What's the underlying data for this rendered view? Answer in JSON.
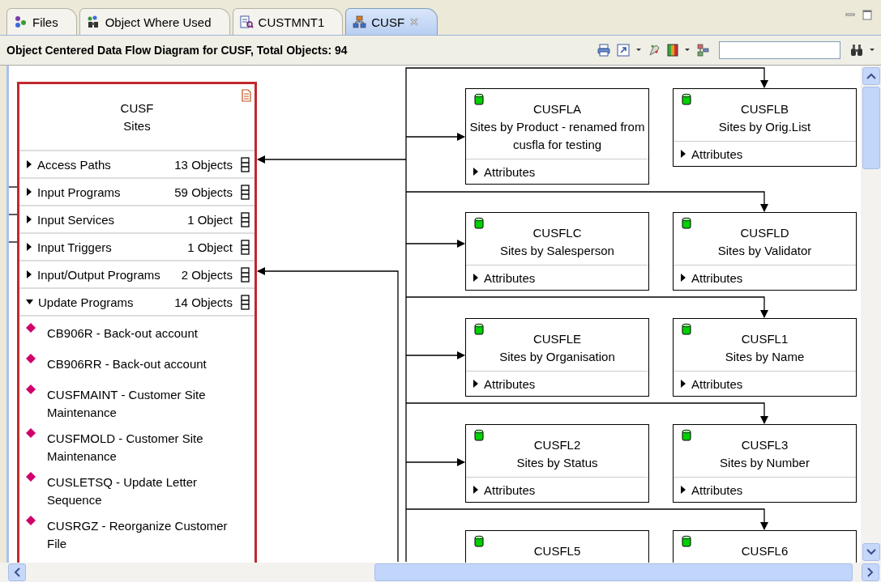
{
  "tabs": [
    {
      "label": "Files",
      "selected": false
    },
    {
      "label": "Object Where Used",
      "selected": false
    },
    {
      "label": "CUSTMNT1",
      "selected": false
    },
    {
      "label": "CUSF",
      "selected": true
    }
  ],
  "header": {
    "title": "Object Centered Data Flow Diagram for CUSF, Total Objects: 94"
  },
  "main_object": {
    "name": "CUSF",
    "description": "Sites",
    "sections": [
      {
        "label": "Access Paths",
        "count": "13 Objects",
        "expanded": false
      },
      {
        "label": "Input Programs",
        "count": "59 Objects",
        "expanded": false
      },
      {
        "label": "Input Services",
        "count": "1 Object",
        "expanded": false
      },
      {
        "label": "Input Triggers",
        "count": "1 Object",
        "expanded": false
      },
      {
        "label": "Input/Output Programs",
        "count": "2 Objects",
        "expanded": false
      },
      {
        "label": "Update Programs",
        "count": "14 Objects",
        "expanded": true,
        "items": [
          {
            "text": "CB906R - Back-out account"
          },
          {
            "text": "CB906RR - Back-out account"
          },
          {
            "text": "CUSFMAINT - Customer Site Maintenance"
          },
          {
            "text": "CUSFMOLD - Customer Site Maintenance"
          },
          {
            "text": "CUSLETSQ - Update Letter Sequence"
          },
          {
            "text": "CUSRGZ - Reorganize Customer File"
          }
        ]
      }
    ]
  },
  "access_paths": [
    {
      "name": "CUSFLA",
      "description": "Sites by Product - renamed from cusfla for testing",
      "section": "Attributes",
      "expanded": false
    },
    {
      "name": "CUSFLB",
      "description": "Sites by Orig.List",
      "section": "Attributes",
      "expanded": false
    },
    {
      "name": "CUSFLC",
      "description": "Sites by Salesperson",
      "section": "Attributes",
      "expanded": false
    },
    {
      "name": "CUSFLD",
      "description": "Sites by Validator",
      "section": "Attributes",
      "expanded": false
    },
    {
      "name": "CUSFLE",
      "description": "Sites by Organisation",
      "section": "Attributes",
      "expanded": false
    },
    {
      "name": "CUSFL1",
      "description": "Sites by Name",
      "section": "Attributes",
      "expanded": false
    },
    {
      "name": "CUSFL2",
      "description": "Sites by Status",
      "section": "Attributes",
      "expanded": false
    },
    {
      "name": "CUSFL3",
      "description": "Sites by Number",
      "section": "Attributes",
      "expanded": false
    },
    {
      "name": "CUSFL5"
    },
    {
      "name": "CUSFL6"
    }
  ]
}
